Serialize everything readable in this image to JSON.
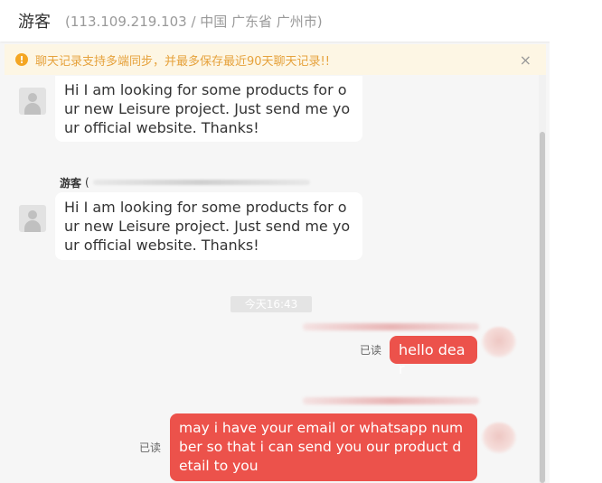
{
  "header": {
    "visitor_name": "游客",
    "visitor_meta": "(113.109.219.103 / 中国 广东省 广州市)"
  },
  "notice": {
    "icon": "warning-icon",
    "text": "聊天记录支持多端同步，并最多保存最近90天聊天记录!!",
    "close_icon": "close-icon"
  },
  "messages": {
    "incoming_1": {
      "text": "Hi I am looking for some products for our new Leisure project. Just send me your official website. Thanks!"
    },
    "incoming_2": {
      "sender_name": "游客",
      "sender_paren": "(",
      "text": "Hi I am looking for some products for our new Leisure project. Just send me your official website. Thanks!"
    },
    "time_separator": "今天16:43",
    "outgoing_1": {
      "status": "已读",
      "text": "hello dear"
    },
    "outgoing_2": {
      "status": "已读",
      "text": "may i have your email or whatsapp number so that i can send you our product detail to you"
    }
  },
  "colors": {
    "outgoing_bubble": "#ec524b",
    "notice_bg": "#fdf6e4",
    "notice_text": "#e6a23c",
    "warn_icon": "#f4a623"
  }
}
